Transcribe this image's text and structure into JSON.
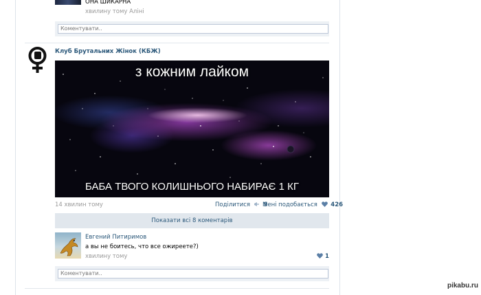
{
  "top_comment": {
    "text": "ОНА ШИКАРНА",
    "meta": "хвилину тому Аліні"
  },
  "comment_placeholder": "Коментувати..",
  "post": {
    "group_name": "Клуб Брутальних Жінок (КБЖ)",
    "image_caption_top": "з кожним лайком",
    "image_caption_bottom": "БАБА ТВОГО КОЛИШНЬОГО НАБИРАЄ 1 КГ",
    "time": "14 хвилин тому",
    "share_label": "Поділитися",
    "share_count": "9",
    "like_label": "Мені подобається",
    "like_count": "426",
    "show_all_comments": "Показати всі 8 коментарів"
  },
  "comment": {
    "author": "Евгений Питиримов",
    "text": "а вы не боитесь, что все ожиреете?)",
    "meta": "хвилину тому",
    "like_count": "1"
  },
  "watermark": "pikabu.ru",
  "colors": {
    "link": "#2b587a",
    "muted": "#999999",
    "panel": "#edf1f5",
    "heart": "#5b7fa6"
  },
  "icons": [
    "group-logo-icon",
    "megaphone-icon",
    "heart-icon"
  ]
}
